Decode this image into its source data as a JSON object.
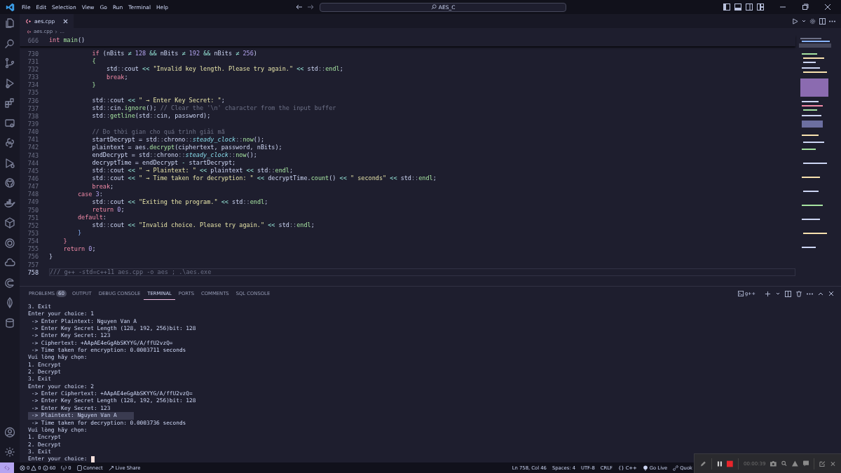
{
  "title_bar": {
    "menu": [
      "File",
      "Edit",
      "Selection",
      "View",
      "Go",
      "Run",
      "Terminal",
      "Help"
    ],
    "search": "AES_C"
  },
  "editor": {
    "tab": {
      "label": "aes.cpp",
      "selected": true
    },
    "breadcrumb": [
      "aes.cpp",
      "..."
    ],
    "sticky_line": {
      "number": "666",
      "tokens": [
        {
          "kind": "keyword",
          "text": "int"
        },
        {
          "kind": "function",
          "text": " main"
        },
        {
          "kind": "plain",
          "text": "()"
        }
      ]
    },
    "lines": [
      {
        "number": "730",
        "current": false,
        "tokens": [
          {
            "kind": "keyword",
            "text": "            if"
          },
          {
            "kind": "plain",
            "text": " (nBits "
          },
          {
            "kind": "operator",
            "text": "≠"
          },
          {
            "kind": "number",
            "text": " 128 "
          },
          {
            "kind": "operator",
            "text": "&&"
          },
          {
            "kind": "plain",
            "text": " nBits "
          },
          {
            "kind": "operator",
            "text": "≠"
          },
          {
            "kind": "number",
            "text": " 192 "
          },
          {
            "kind": "operator",
            "text": "&&"
          },
          {
            "kind": "plain",
            "text": " nBits "
          },
          {
            "kind": "operator",
            "text": "≠"
          },
          {
            "kind": "number",
            "text": " 256"
          },
          {
            "kind": "plain",
            "text": ")"
          }
        ]
      },
      {
        "number": "731",
        "current": false,
        "tokens": [
          {
            "kind": "function",
            "text": "            {"
          }
        ]
      },
      {
        "number": "732",
        "current": false,
        "tokens": [
          {
            "kind": "plain",
            "text": "                std"
          },
          {
            "kind": "scope",
            "text": "::"
          },
          {
            "kind": "plain",
            "text": "cout "
          },
          {
            "kind": "operator",
            "text": "<<"
          },
          {
            "kind": "string",
            "text": " \"Invalid key length. Please try again.\" "
          },
          {
            "kind": "operator",
            "text": "<<"
          },
          {
            "kind": "plain",
            "text": " std"
          },
          {
            "kind": "scope",
            "text": "::"
          },
          {
            "kind": "function",
            "text": "endl"
          },
          {
            "kind": "plain",
            "text": ";"
          }
        ]
      },
      {
        "number": "733",
        "current": false,
        "tokens": [
          {
            "kind": "keyword",
            "text": "                break"
          },
          {
            "kind": "plain",
            "text": ";"
          }
        ]
      },
      {
        "number": "734",
        "current": false,
        "tokens": [
          {
            "kind": "function",
            "text": "            }"
          }
        ]
      },
      {
        "number": "735",
        "current": false
      },
      {
        "number": "736",
        "current": false,
        "tokens": [
          {
            "kind": "plain",
            "text": "            std"
          },
          {
            "kind": "scope",
            "text": "::"
          },
          {
            "kind": "plain",
            "text": "cout "
          },
          {
            "kind": "operator",
            "text": "<<"
          },
          {
            "kind": "string",
            "text": " \" → Enter Key Secret: \""
          },
          {
            "kind": "plain",
            "text": ";"
          }
        ]
      },
      {
        "number": "737",
        "current": false,
        "tokens": [
          {
            "kind": "plain",
            "text": "            std"
          },
          {
            "kind": "scope",
            "text": "::"
          },
          {
            "kind": "plain",
            "text": "cin."
          },
          {
            "kind": "function",
            "text": "ignore"
          },
          {
            "kind": "plain",
            "text": "(); "
          },
          {
            "kind": "comment",
            "text": "// Clear the '\\n' character from the input buffer"
          }
        ]
      },
      {
        "number": "738",
        "current": false,
        "tokens": [
          {
            "kind": "plain",
            "text": "            std"
          },
          {
            "kind": "scope",
            "text": "::"
          },
          {
            "kind": "function",
            "text": "getline"
          },
          {
            "kind": "plain",
            "text": "(std"
          },
          {
            "kind": "scope",
            "text": "::"
          },
          {
            "kind": "plain",
            "text": "cin, password);"
          }
        ]
      },
      {
        "number": "739",
        "current": false
      },
      {
        "number": "740",
        "current": false,
        "tokens": [
          {
            "kind": "comment",
            "text": "            // Đo thời gian cho quá trình giải mã"
          }
        ]
      },
      {
        "number": "741",
        "current": false,
        "tokens": [
          {
            "kind": "plain",
            "text": "            startDecrypt = std"
          },
          {
            "kind": "scope",
            "text": "::"
          },
          {
            "kind": "plain",
            "text": "chrono"
          },
          {
            "kind": "scope",
            "text": "::"
          },
          {
            "kind": "type",
            "text": "steady_clock"
          },
          {
            "kind": "scope",
            "text": "::"
          },
          {
            "kind": "function",
            "text": "now"
          },
          {
            "kind": "plain",
            "text": "();"
          }
        ]
      },
      {
        "number": "742",
        "current": false,
        "tokens": [
          {
            "kind": "plain",
            "text": "            plaintext = aes."
          },
          {
            "kind": "function",
            "text": "decrypt"
          },
          {
            "kind": "plain",
            "text": "(ciphertext, password, nBits);"
          }
        ]
      },
      {
        "number": "743",
        "current": false,
        "tokens": [
          {
            "kind": "plain",
            "text": "            endDecrypt = std"
          },
          {
            "kind": "scope",
            "text": "::"
          },
          {
            "kind": "plain",
            "text": "chrono"
          },
          {
            "kind": "scope",
            "text": "::"
          },
          {
            "kind": "type",
            "text": "steady_clock"
          },
          {
            "kind": "scope",
            "text": "::"
          },
          {
            "kind": "function",
            "text": "now"
          },
          {
            "kind": "plain",
            "text": "();"
          }
        ]
      },
      {
        "number": "744",
        "current": false,
        "tokens": [
          {
            "kind": "plain",
            "text": "            decryptTime = endDecrypt "
          },
          {
            "kind": "operator",
            "text": "-"
          },
          {
            "kind": "plain",
            "text": " startDecrypt;"
          }
        ]
      },
      {
        "number": "745",
        "current": false,
        "tokens": [
          {
            "kind": "plain",
            "text": "            std"
          },
          {
            "kind": "scope",
            "text": "::"
          },
          {
            "kind": "plain",
            "text": "cout "
          },
          {
            "kind": "operator",
            "text": "<<"
          },
          {
            "kind": "string",
            "text": " \" → Plaintext: \" "
          },
          {
            "kind": "operator",
            "text": "<<"
          },
          {
            "kind": "plain",
            "text": " plaintext "
          },
          {
            "kind": "operator",
            "text": "<<"
          },
          {
            "kind": "plain",
            "text": " std"
          },
          {
            "kind": "scope",
            "text": "::"
          },
          {
            "kind": "function",
            "text": "endl"
          },
          {
            "kind": "plain",
            "text": ";"
          }
        ]
      },
      {
        "number": "746",
        "current": false,
        "tokens": [
          {
            "kind": "plain",
            "text": "            std"
          },
          {
            "kind": "scope",
            "text": "::"
          },
          {
            "kind": "plain",
            "text": "cout "
          },
          {
            "kind": "operator",
            "text": "<<"
          },
          {
            "kind": "string",
            "text": " \" → Time taken for decryption: \" "
          },
          {
            "kind": "operator",
            "text": "<<"
          },
          {
            "kind": "plain",
            "text": " decryptTime."
          },
          {
            "kind": "function",
            "text": "count"
          },
          {
            "kind": "plain",
            "text": "() "
          },
          {
            "kind": "operator",
            "text": "<<"
          },
          {
            "kind": "string",
            "text": " \" seconds\" "
          },
          {
            "kind": "operator",
            "text": "<<"
          },
          {
            "kind": "plain",
            "text": " std"
          },
          {
            "kind": "scope",
            "text": "::"
          },
          {
            "kind": "function",
            "text": "endl"
          },
          {
            "kind": "plain",
            "text": ";"
          }
        ]
      },
      {
        "number": "747",
        "current": false,
        "tokens": [
          {
            "kind": "keyword",
            "text": "            break"
          },
          {
            "kind": "plain",
            "text": ";"
          }
        ]
      },
      {
        "number": "748",
        "current": false,
        "tokens": [
          {
            "kind": "keyword",
            "text": "        case"
          },
          {
            "kind": "number",
            "text": " 3"
          },
          {
            "kind": "plain",
            "text": ":"
          }
        ]
      },
      {
        "number": "749",
        "current": false,
        "tokens": [
          {
            "kind": "plain",
            "text": "            std"
          },
          {
            "kind": "scope",
            "text": "::"
          },
          {
            "kind": "plain",
            "text": "cout "
          },
          {
            "kind": "operator",
            "text": "<<"
          },
          {
            "kind": "string",
            "text": " \"Exiting the program.\" "
          },
          {
            "kind": "operator",
            "text": "<<"
          },
          {
            "kind": "plain",
            "text": " std"
          },
          {
            "kind": "scope",
            "text": "::"
          },
          {
            "kind": "function",
            "text": "endl"
          },
          {
            "kind": "plain",
            "text": ";"
          }
        ]
      },
      {
        "number": "750",
        "current": false,
        "tokens": [
          {
            "kind": "keyword",
            "text": "            return"
          },
          {
            "kind": "number",
            "text": " 0"
          },
          {
            "kind": "plain",
            "text": ";"
          }
        ]
      },
      {
        "number": "751",
        "current": false,
        "tokens": [
          {
            "kind": "keyword",
            "text": "        default"
          },
          {
            "kind": "plain",
            "text": ":"
          }
        ]
      },
      {
        "number": "752",
        "current": false,
        "tokens": [
          {
            "kind": "plain",
            "text": "            std"
          },
          {
            "kind": "scope",
            "text": "::"
          },
          {
            "kind": "plain",
            "text": "cout "
          },
          {
            "kind": "operator",
            "text": "<<"
          },
          {
            "kind": "string",
            "text": " \"Invalid choice. Please try again.\" "
          },
          {
            "kind": "operator",
            "text": "<<"
          },
          {
            "kind": "plain",
            "text": " std"
          },
          {
            "kind": "scope",
            "text": "::"
          },
          {
            "kind": "function",
            "text": "endl"
          },
          {
            "kind": "plain",
            "text": ";"
          }
        ]
      },
      {
        "number": "753",
        "current": false,
        "tokens": [
          {
            "kind": "bracket",
            "text": "        }"
          }
        ]
      },
      {
        "number": "754",
        "current": false,
        "tokens": [
          {
            "kind": "keyword",
            "text": "    }"
          }
        ]
      },
      {
        "number": "755",
        "current": false,
        "tokens": [
          {
            "kind": "keyword",
            "text": "    return"
          },
          {
            "kind": "number",
            "text": " 0"
          },
          {
            "kind": "plain",
            "text": ";"
          }
        ]
      },
      {
        "number": "756",
        "current": false,
        "tokens": [
          {
            "kind": "plain",
            "text": "}"
          }
        ]
      },
      {
        "number": "757",
        "current": false
      },
      {
        "number": "758",
        "current": true,
        "tokens": [
          {
            "kind": "comment",
            "text": "/// g++ -std=c++11 aes.cpp -o aes ; .\\aes.exe"
          }
        ]
      }
    ]
  },
  "panel": {
    "tabs": [
      {
        "label": "PROBLEMS",
        "badge": "60",
        "selected": false
      },
      {
        "label": "OUTPUT",
        "selected": false
      },
      {
        "label": "DEBUG CONSOLE",
        "selected": false
      },
      {
        "label": "TERMINAL",
        "selected": true
      },
      {
        "label": "PORTS",
        "selected": false
      },
      {
        "label": "COMMENTS",
        "selected": false
      },
      {
        "label": "SQL CONSOLE",
        "selected": false
      }
    ],
    "terminal_profile": "g++",
    "terminal_lines": [
      {
        "text": "3. Exit",
        "selected": false
      },
      {
        "text": "Enter your choice: 1",
        "selected": false
      },
      {
        "text": " -> Enter Plaintext: Nguyen Van A",
        "selected": false
      },
      {
        "text": " -> Enter Key Secret Length (128, 192, 256)bit: 128",
        "selected": false
      },
      {
        "text": " -> Enter Key Secret: 123",
        "selected": false
      },
      {
        "text": " -> Ciphertext: +AApAE4eGgAbSKYYG/A/ffU2vzQ=",
        "selected": false
      },
      {
        "text": " -> Time taken for encryption: 0.0003711 seconds",
        "selected": false
      },
      {
        "text": "Vui lòng hãy chọn:",
        "selected": false
      },
      {
        "text": "1. Encrypt",
        "selected": false
      },
      {
        "text": "2. Decrypt",
        "selected": false
      },
      {
        "text": "3. Exit",
        "selected": false
      },
      {
        "text": "Enter your choice: 2",
        "selected": false
      },
      {
        "text": " -> Enter Ciphertext: +AApAE4eGgAbSKYYG/A/ffU2vzQ=",
        "selected": false
      },
      {
        "text": " -> Enter Key Secret Length (128, 192, 256)bit: 128",
        "selected": false
      },
      {
        "text": " -> Enter Key Secret: 123",
        "selected": false
      },
      {
        "text": " -> Plaintext: Nguyen Van A",
        "selected": true
      },
      {
        "text": " -> Time taken for decryption: 0.0003736 seconds",
        "selected": false
      },
      {
        "text": "Vui lòng hãy chọn:",
        "selected": false
      },
      {
        "text": "1. Encrypt",
        "selected": false
      },
      {
        "text": "2. Decrypt",
        "selected": false
      },
      {
        "text": "3. Exit",
        "selected": false
      },
      {
        "text": "Enter your choice:",
        "selected": false
      }
    ]
  },
  "status_bar": {
    "errors": "0",
    "warnings": "0",
    "infos": "60",
    "ports": "0",
    "connect": "Connect",
    "live_share": "Live Share",
    "position": "Ln 758, Col 46",
    "spaces": "Spaces: 4",
    "encoding": "UTF-8",
    "eol": "CRLF",
    "language_icon": "{}",
    "language": "C++",
    "go_live": "Go Live",
    "extension": "Quok"
  },
  "recorder": {
    "timer": "00:00:39"
  }
}
